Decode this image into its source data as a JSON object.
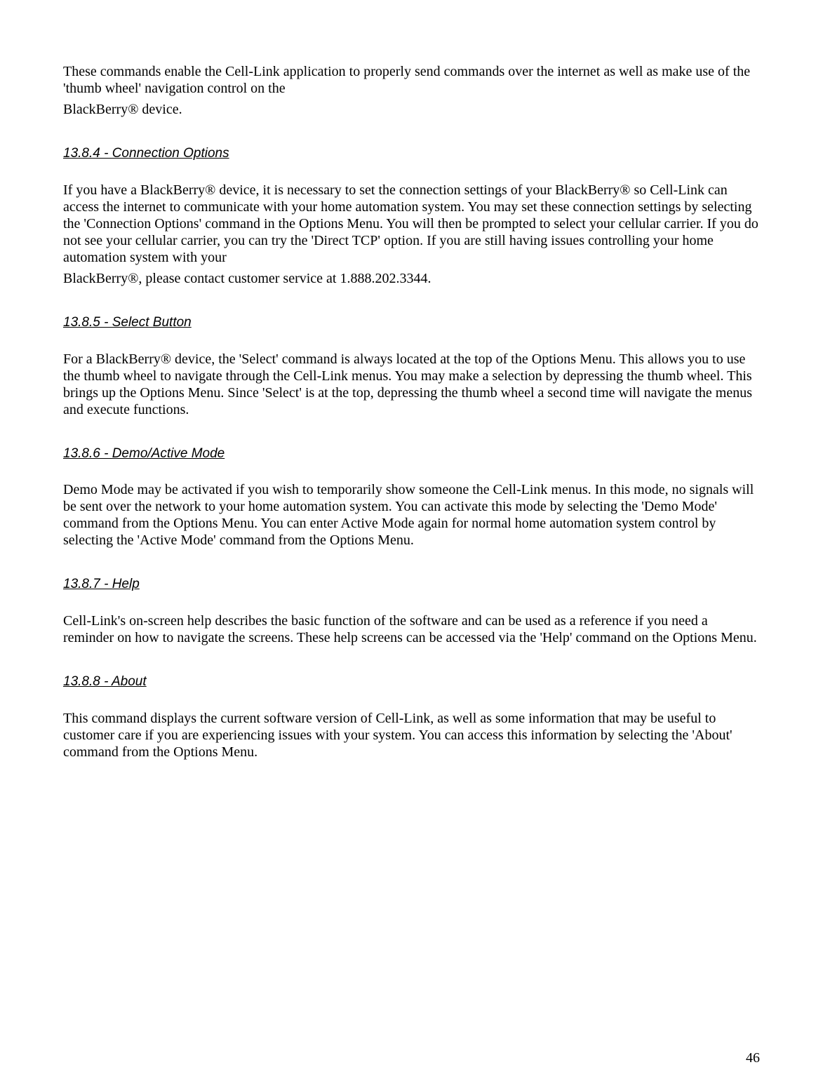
{
  "intro": {
    "p1": "These commands enable the Cell-Link application to properly send commands over the internet as well as make use of the 'thumb wheel' navigation control on the",
    "p2": "BlackBerry® device."
  },
  "sections": {
    "s1": {
      "heading": "13.8.4 - Connection Options",
      "p1": "If you have a BlackBerry® device, it is necessary to set the connection settings of your BlackBerry® so Cell-Link can access the internet to communicate with your home automation system. You may set these connection settings by selecting the 'Connection Options' command in the Options Menu. You will then be prompted to select your cellular carrier. If you do not see your cellular carrier, you can try the 'Direct TCP' option. If you are still having issues controlling your home automation system with your",
      "p2": "BlackBerry®, please contact customer service at 1.888.202.3344."
    },
    "s2": {
      "heading": "13.8.5 - Select Button",
      "p1": "For a BlackBerry® device, the 'Select' command is always located at the top of the Options Menu. This allows you to use the thumb wheel to navigate through the Cell-Link menus. You may make a selection by depressing the thumb wheel. This brings up the Options Menu.  Since 'Select' is at the top, depressing the thumb wheel a second time will navigate the menus and execute functions."
    },
    "s3": {
      "heading": "13.8.6 - Demo/Active Mode",
      "p1": "Demo Mode may be activated if you wish to temporarily show someone the Cell-Link menus. In this mode, no signals will be sent over the network to your home automation system. You can activate this mode by selecting the 'Demo Mode' command from the Options Menu. You can enter Active Mode again for normal home automation system control by selecting the 'Active Mode' command from the Options Menu."
    },
    "s4": {
      "heading": "13.8.7 - Help",
      "p1": "Cell-Link's on-screen help describes the basic function of the software and can be used as a reference if you need a reminder on how to navigate the screens. These help screens can be accessed via the 'Help' command on the Options Menu."
    },
    "s5": {
      "heading": "13.8.8 - About",
      "p1": "This command displays the current software version of Cell-Link, as well as some information that may be useful to customer care if you are experiencing issues with your system. You can access this information by selecting the 'About' command from the Options Menu."
    }
  },
  "page_number": "46"
}
